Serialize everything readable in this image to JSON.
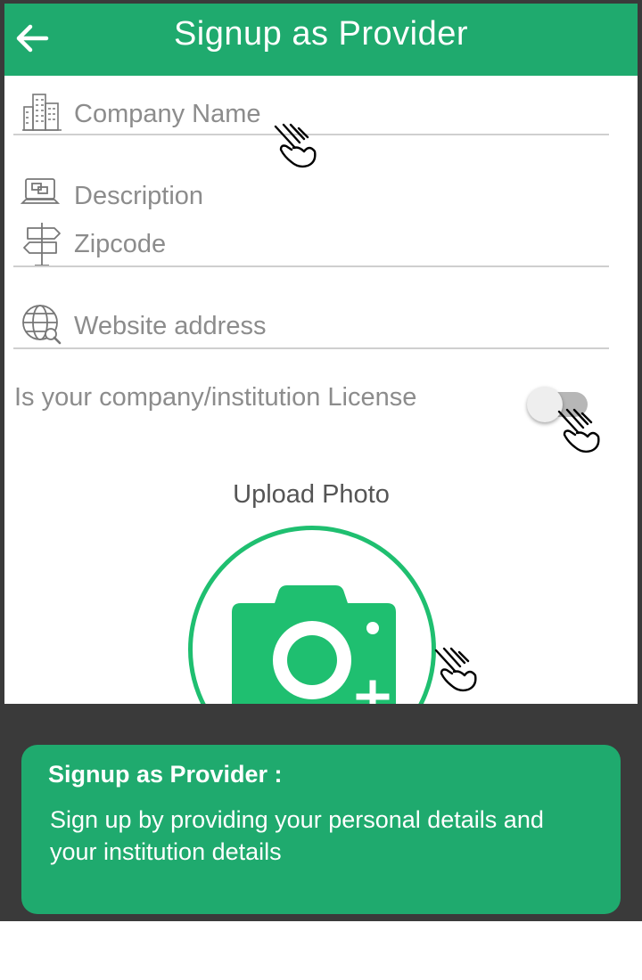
{
  "header": {
    "title": "Signup as Provider",
    "back_icon": "arrow-left-icon"
  },
  "form": {
    "company_name": {
      "placeholder": "Company Name",
      "icon": "building-icon"
    },
    "description": {
      "placeholder": "Description",
      "icon": "monitor-icon"
    },
    "zipcode": {
      "placeholder": "Zipcode",
      "icon": "signpost-icon"
    },
    "website": {
      "placeholder": "Website address",
      "icon": "globe-search-icon"
    },
    "license": {
      "label": "Is your company/institution License",
      "enabled": false
    }
  },
  "upload": {
    "label": "Upload Photo",
    "icon": "camera-add-icon"
  },
  "info_card": {
    "title": "Signup as Provider :",
    "body": "Sign up by providing your personal details and your institution details"
  },
  "colors": {
    "brand_green": "#1faa6e",
    "camera_green": "#1fbf70",
    "frame": "#3a3a3a"
  }
}
